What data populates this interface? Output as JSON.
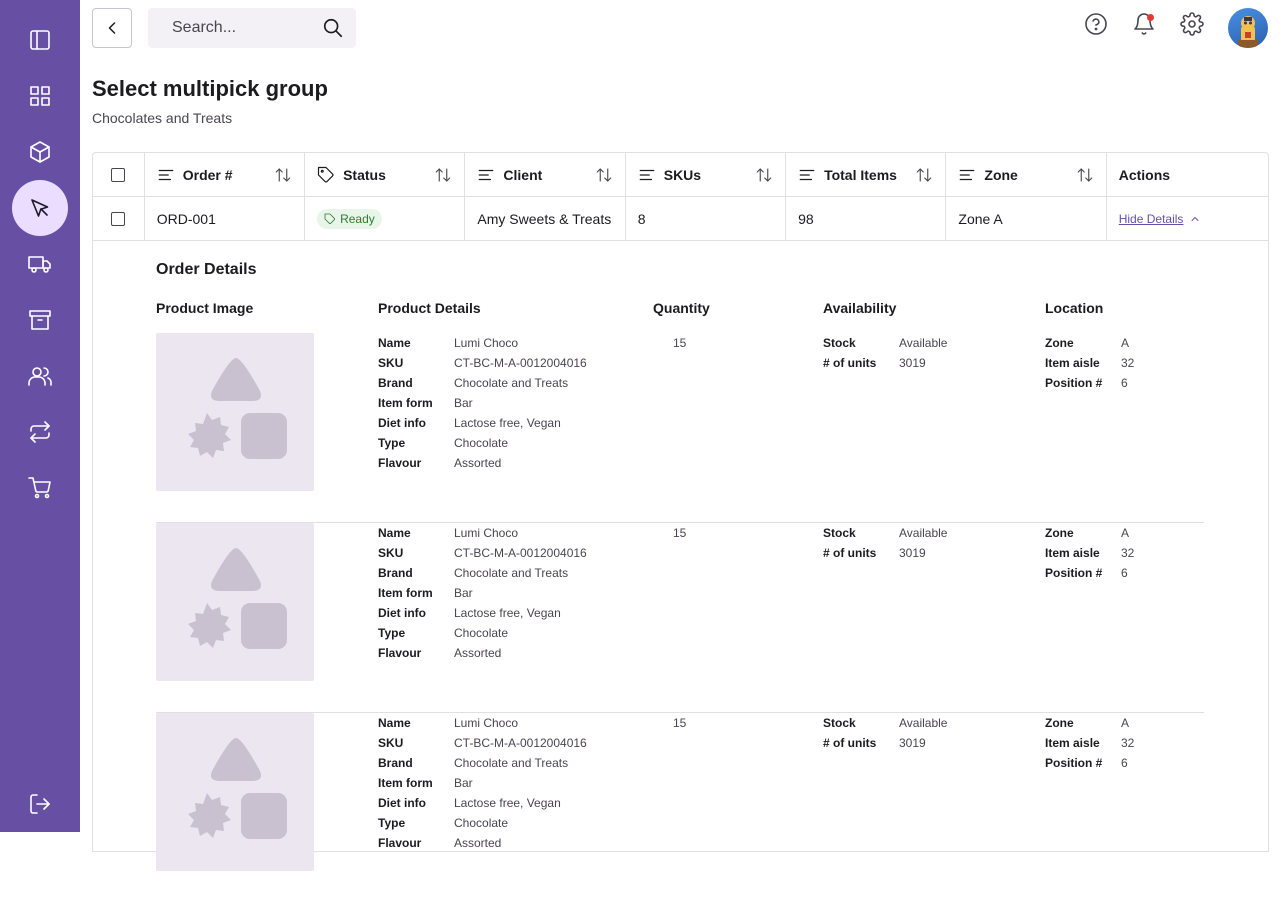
{
  "nav": {
    "items": [
      {
        "name": "sidebar-toggle",
        "icon": "sidebar-panel-icon"
      },
      {
        "name": "dashboard",
        "icon": "grid-icon"
      },
      {
        "name": "products",
        "icon": "cube-icon"
      },
      {
        "name": "picking",
        "icon": "cursor-icon",
        "active": true
      },
      {
        "name": "shipping",
        "icon": "truck-icon"
      },
      {
        "name": "storage",
        "icon": "archive-icon"
      },
      {
        "name": "users",
        "icon": "users-icon"
      },
      {
        "name": "transfers",
        "icon": "repeat-icon"
      },
      {
        "name": "orders",
        "icon": "cart-icon"
      }
    ],
    "logout_icon": "logout-icon",
    "accent": "#6750a4",
    "active_bg": "#eaddff"
  },
  "search": {
    "placeholder": "Search...",
    "value": ""
  },
  "page": {
    "title": "Select multipick group",
    "subtitle": "Chocolates and Treats"
  },
  "table": {
    "columns": [
      "Order #",
      "Status",
      "Client",
      "SKUs",
      "Total Items",
      "Zone",
      "Actions"
    ],
    "row": {
      "order": "ORD-001",
      "status": "Ready",
      "client": "Amy Sweets & Treats",
      "skus": "8",
      "total_items": "98",
      "zone": "Zone A",
      "action": "Hide Details"
    },
    "status_color": "#2e7d32"
  },
  "details": {
    "title": "Order Details",
    "headers": {
      "image": "Product Image",
      "product": "Product Details",
      "quantity": "Quantity",
      "availability": "Availability",
      "location": "Location"
    },
    "labels": {
      "name": "Name",
      "sku": "SKU",
      "brand": "Brand",
      "item_form": "Item form",
      "diet": "Diet info",
      "type": "Type",
      "flavour": "Flavour",
      "stock": "Stock",
      "units": "# of units",
      "zone": "Zone",
      "aisle": "Item aisle",
      "position": "Position #"
    },
    "items": [
      {
        "name": "Lumi Choco",
        "sku": "CT-BC-M-A-0012004016",
        "brand": "Chocolate and Treats",
        "item_form": "Bar",
        "diet": "Lactose free, Vegan",
        "type": "Chocolate",
        "flavour": "Assorted",
        "quantity": "15",
        "stock": "Available",
        "units": "3019",
        "zone": "A",
        "aisle": "32",
        "position": "6"
      },
      {
        "name": "Lumi Choco",
        "sku": "CT-BC-M-A-0012004016",
        "brand": "Chocolate and Treats",
        "item_form": "Bar",
        "diet": "Lactose free, Vegan",
        "type": "Chocolate",
        "flavour": "Assorted",
        "quantity": "15",
        "stock": "Available",
        "units": "3019",
        "zone": "A",
        "aisle": "32",
        "position": "6"
      },
      {
        "name": "Lumi Choco",
        "sku": "CT-BC-M-A-0012004016",
        "brand": "Chocolate and Treats",
        "item_form": "Bar",
        "diet": "Lactose free, Vegan",
        "type": "Chocolate",
        "flavour": "Assorted",
        "quantity": "15",
        "stock": "Available",
        "units": "3019",
        "zone": "A",
        "aisle": "32",
        "position": "6"
      }
    ]
  }
}
